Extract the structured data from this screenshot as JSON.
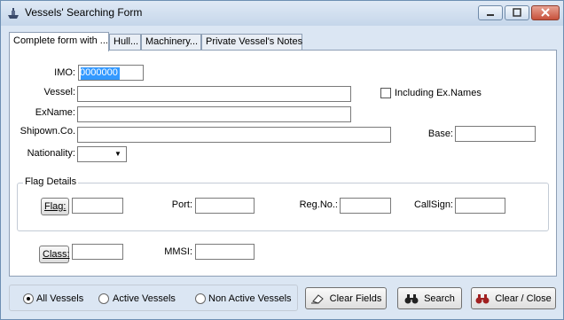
{
  "window": {
    "title": "Vessels' Searching Form",
    "icon": "ship-icon"
  },
  "tabs": [
    {
      "label": "Complete form with ...",
      "active": true
    },
    {
      "label": "Hull...",
      "active": false
    },
    {
      "label": "Machinery...",
      "active": false
    },
    {
      "label": "Private Vessel's Notes",
      "active": false
    }
  ],
  "form": {
    "imo_label": "IMO:",
    "imo_value": "0000000",
    "vessel_label": "Vessel:",
    "vessel_value": "",
    "including_ex_names_label": "Including Ex.Names",
    "including_ex_names_checked": false,
    "exname_label": "ExName:",
    "exname_value": "",
    "shipown_label": "Shipown.Co.",
    "shipown_value": "",
    "base_label": "Base:",
    "base_value": "",
    "nationality_label": "Nationality:",
    "nationality_value": ""
  },
  "flag_details": {
    "title": "Flag Details",
    "flag_button": "Flag:",
    "flag_value": "",
    "port_label": "Port:",
    "port_value": "",
    "regno_label": "Reg.No.:",
    "regno_value": "",
    "callsign_label": "CallSign:",
    "callsign_value": ""
  },
  "class_row": {
    "class_button": "Class:",
    "class_value": "",
    "mmsi_label": "MMSI:",
    "mmsi_value": ""
  },
  "filter": {
    "options": [
      "All Vessels",
      "Active Vessels",
      "Non Active Vessels"
    ],
    "selected": "All Vessels"
  },
  "actions": {
    "clear_fields": "Clear Fields",
    "search": "Search",
    "clear_close": "Clear / Close"
  },
  "colors": {
    "selection": "#3399ff",
    "close_button": "#c7513b"
  }
}
